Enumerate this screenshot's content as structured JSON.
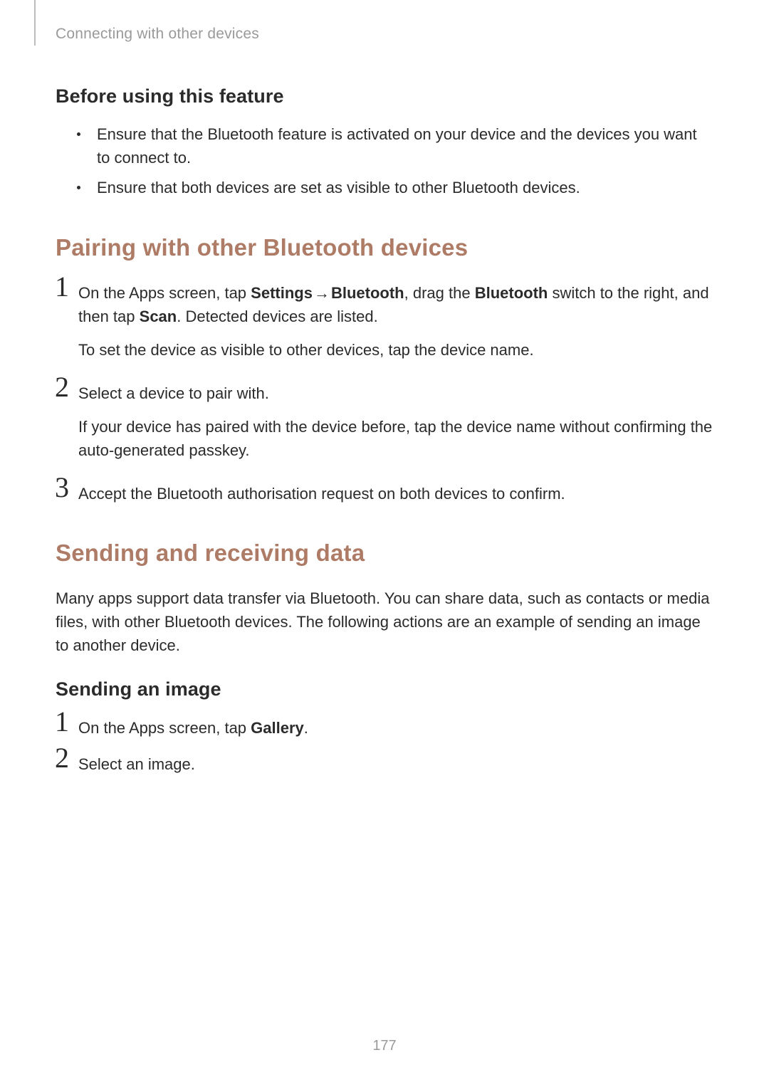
{
  "header": {
    "breadcrumb": "Connecting with other devices"
  },
  "sub1": {
    "title": "Before using this feature",
    "bullets": [
      "Ensure that the Bluetooth feature is activated on your device and the devices you want to connect to.",
      "Ensure that both devices are set as visible to other Bluetooth devices."
    ]
  },
  "section_pairing": {
    "title": "Pairing with other Bluetooth devices",
    "steps": [
      {
        "n": "1",
        "html_parts": {
          "a": "On the Apps screen, tap ",
          "b": "Settings",
          "arrow": " → ",
          "c": "Bluetooth",
          "d": ", drag the ",
          "e": "Bluetooth",
          "f": " switch to the right, and then tap ",
          "g": "Scan",
          "h": ". Detected devices are listed."
        },
        "p2": "To set the device as visible to other devices, tap the device name."
      },
      {
        "n": "2",
        "p1": "Select a device to pair with.",
        "p2": "If your device has paired with the device before, tap the device name without confirming the auto-generated passkey."
      },
      {
        "n": "3",
        "p1": "Accept the Bluetooth authorisation request on both devices to confirm."
      }
    ]
  },
  "section_sending": {
    "title": "Sending and receiving data",
    "intro": "Many apps support data transfer via Bluetooth. You can share data, such as contacts or media files, with other Bluetooth devices. The following actions are an example of sending an image to another device.",
    "sub_title": "Sending an image",
    "steps": [
      {
        "n": "1",
        "html_parts": {
          "a": "On the Apps screen, tap ",
          "b": "Gallery",
          "c": "."
        }
      },
      {
        "n": "2",
        "p1": "Select an image."
      }
    ]
  },
  "page_number": "177"
}
